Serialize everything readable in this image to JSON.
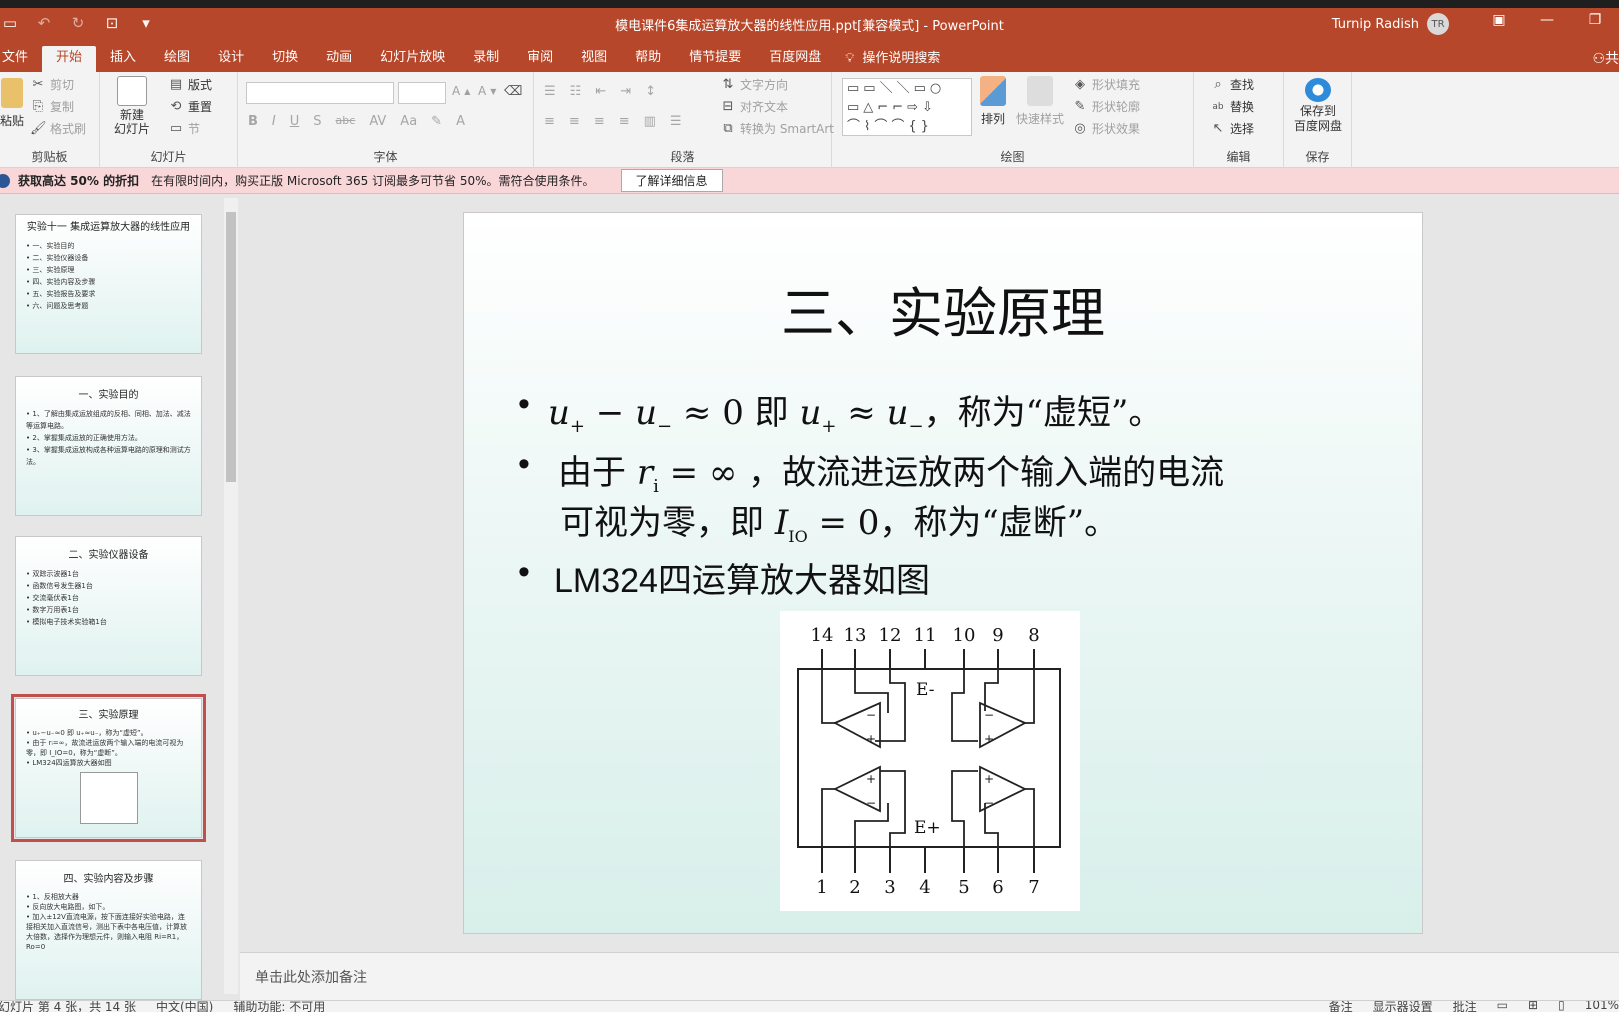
{
  "window": {
    "title": "模电课件6集成运算放大器的线性应用.ppt[兼容模式] - PowerPoint",
    "user_name": "Turnip Radish",
    "user_initials": "TR"
  },
  "qat": {
    "save_icon": "save-icon",
    "undo_icon": "undo-icon",
    "redo_icon": "redo-icon",
    "present_icon": "present-icon",
    "customize_icon": "customize-icon"
  },
  "tabs": [
    {
      "label": "文件"
    },
    {
      "label": "开始"
    },
    {
      "label": "插入"
    },
    {
      "label": "绘图"
    },
    {
      "label": "设计"
    },
    {
      "label": "切换"
    },
    {
      "label": "动画"
    },
    {
      "label": "幻灯片放映"
    },
    {
      "label": "录制"
    },
    {
      "label": "审阅"
    },
    {
      "label": "视图"
    },
    {
      "label": "帮助"
    },
    {
      "label": "情节提要"
    },
    {
      "label": "百度网盘"
    }
  ],
  "tell_me": "操作说明搜索",
  "share_label": "共",
  "ribbon": {
    "clipboard": {
      "label": "剪贴板",
      "paste": "粘贴",
      "cut": "剪切",
      "copy": "复制",
      "format_painter": "格式刷"
    },
    "slides": {
      "label": "幻灯片",
      "new_slide": "新建",
      "new_slide2": "幻灯片",
      "layout": "版式",
      "reset": "重置",
      "section": "节"
    },
    "font": {
      "label": "字体",
      "bold": "B",
      "italic": "I",
      "underline": "U",
      "shadow": "S",
      "strike": "abc",
      "spacing": "AV",
      "case": "Aa",
      "color": "A",
      "grow": "A",
      "shrink": "A"
    },
    "paragraph": {
      "label": "段落",
      "text_direction": "文字方向",
      "align_text": "对齐文本",
      "smartart": "转换为 SmartArt"
    },
    "drawing": {
      "label": "绘图",
      "arrange": "排列",
      "quick_styles": "快速样式",
      "shape_fill": "形状填充",
      "shape_outline": "形状轮廓",
      "shape_effects": "形状效果"
    },
    "editing": {
      "label": "编辑",
      "find": "查找",
      "replace": "替换",
      "select": "选择"
    },
    "save": {
      "label": "保存",
      "save_to": "保存到",
      "baidu": "百度网盘"
    }
  },
  "notice": {
    "bold": "获取高达 50% 的折扣",
    "text": "在有限时间内，购买正版 Microsoft 365 订阅最多可节省 50%。需符合使用条件。",
    "button": "了解详细信息"
  },
  "thumbnails": [
    {
      "title": "实验十一 集成运算放大器的线性应用",
      "items": [
        "一、实验目的",
        "二、实验仪器设备",
        "三、实验原理",
        "四、实验内容及步骤",
        "五、实验报告及要求",
        "六、问题及思考题"
      ]
    },
    {
      "title": "一、实验目的",
      "items": [
        "1、了解由集成运放组成的反相、同相、加法、减法等运算电路。",
        "2、掌握集成运放的正确使用方法。",
        "3、掌握集成运放构成各种运算电路的原理和测试方法。"
      ]
    },
    {
      "title": "二、实验仪器设备",
      "items": [
        "双踪示波器1台",
        "函数信号发生器1台",
        "交流毫伏表1台",
        "数字万用表1台",
        "模拟电子技术实验箱1台"
      ]
    },
    {
      "title": "三、实验原理",
      "items": [
        "u₊−u₋≈0 即 u₊≈u₋，称为“虚短”。",
        "由于 rᵢ=∞，故流进运放两个输入端的电流可视为零，即 I_IO=0，称为“虚断”。",
        "LM324四运算放大器如图"
      ]
    },
    {
      "title": "四、实验内容及步骤",
      "items": [
        "1、反相放大器",
        "反向放大电路图，如下。",
        "加入±12V直流电源，按下面连接好实验电路，连接相关加入直流信号，测出下表中各电压值，计算放大倍数，选择作为理想元件，则输入电阻 Ri=R1，Ro=0"
      ]
    }
  ],
  "slide": {
    "title": "三、实验原理",
    "bullet1_var1": "u",
    "bullet1_sub1": "+",
    "bullet1_op1": " − ",
    "bullet1_var2": "u",
    "bullet1_sub2": "−",
    "bullet1_mid": " ≈ 0 即 ",
    "bullet1_var3": "u",
    "bullet1_sub3": "+",
    "bullet1_op2": " ≈ ",
    "bullet1_var4": "u",
    "bullet1_sub4": "−",
    "bullet1_end": "，称为“虚短”。",
    "bullet2_line1_a": "由于 ",
    "bullet2_var": "r",
    "bullet2_sub": "i",
    "bullet2_line1_b": " = ∞ ，故流进运放两个输入端的电流",
    "bullet2_line2_a": "可视为零，即 ",
    "bullet2_var2": "I",
    "bullet2_sub2": "IO",
    "bullet2_line2_b": " = 0，称为“虚断”。",
    "bullet3": "LM324四运算放大器如图",
    "diagram": {
      "top_pins": [
        "14",
        "13",
        "12",
        "11",
        "10",
        "9",
        "8"
      ],
      "bottom_pins": [
        "1",
        "2",
        "3",
        "4",
        "5",
        "6",
        "7"
      ],
      "label_top": "E-",
      "label_bottom": "E+",
      "plus": "+",
      "minus": "−"
    }
  },
  "notes_placeholder": "单击此处添加备注",
  "status": {
    "slide_info": "幻灯片 第 4 张，共 14 张",
    "language": "中文(中国)",
    "accessibility": "辅助功能: 不可用",
    "notes": "备注",
    "display": "显示器设置",
    "comments": "批注",
    "zoom": "101%"
  }
}
